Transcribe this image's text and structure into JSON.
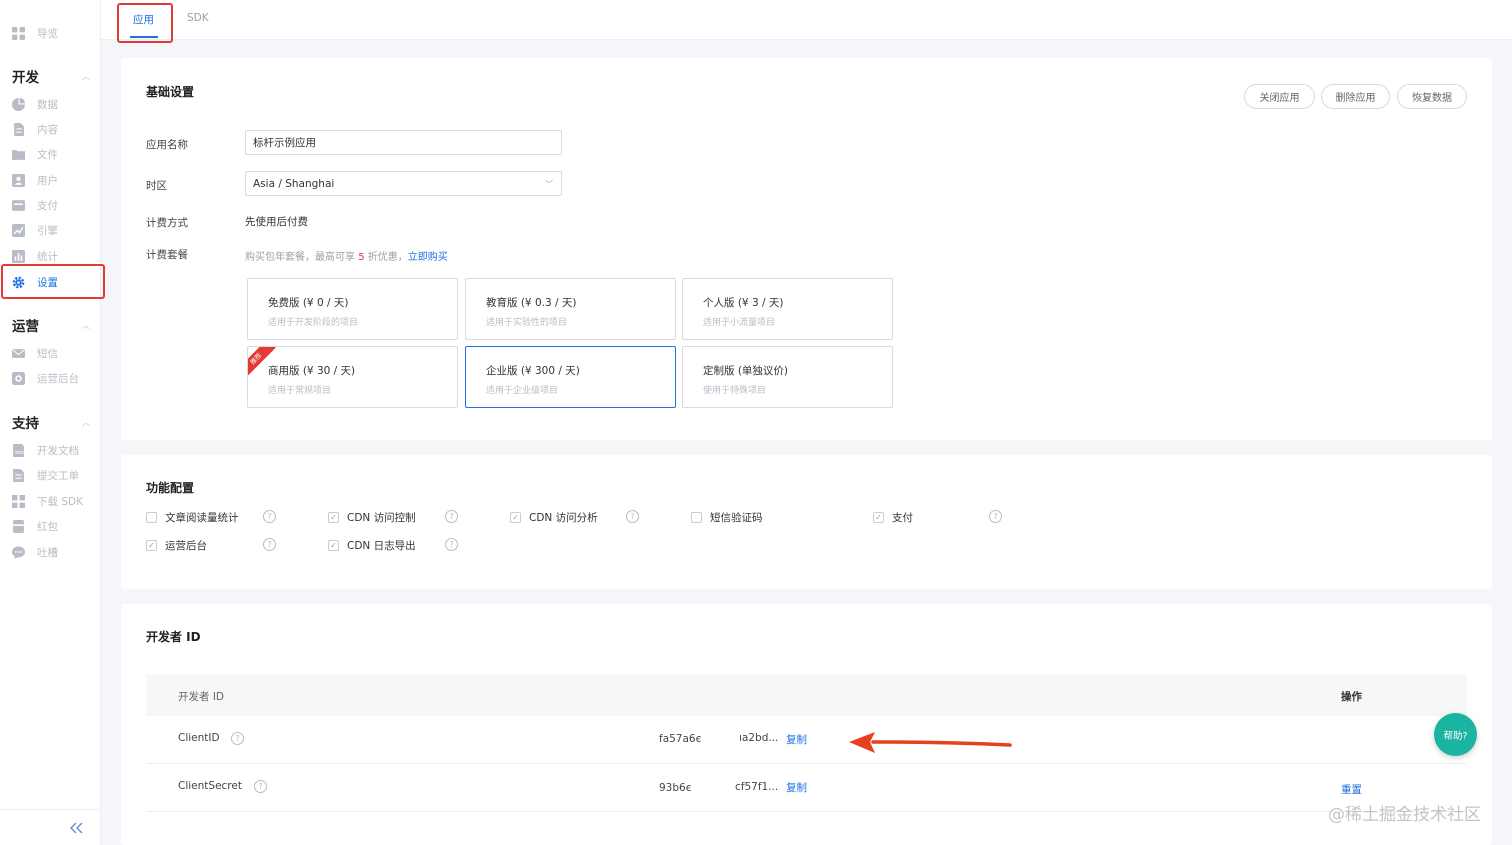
{
  "sidebar": {
    "top_item": {
      "label": "导览",
      "icon": "grid-icon"
    },
    "sections": [
      {
        "title": "开发",
        "items": [
          {
            "label": "数据",
            "icon": "pie-chart-icon"
          },
          {
            "label": "内容",
            "icon": "document-icon"
          },
          {
            "label": "文件",
            "icon": "folder-icon"
          },
          {
            "label": "用户",
            "icon": "user-icon"
          },
          {
            "label": "支付",
            "icon": "wallet-icon"
          },
          {
            "label": "引擎",
            "icon": "trend-icon"
          },
          {
            "label": "统计",
            "icon": "bar-chart-icon"
          },
          {
            "label": "设置",
            "icon": "gear-icon",
            "active": true
          }
        ]
      },
      {
        "title": "运营",
        "items": [
          {
            "label": "短信",
            "icon": "mail-icon"
          },
          {
            "label": "运营后台",
            "icon": "monitor-icon"
          }
        ]
      },
      {
        "title": "支持",
        "items": [
          {
            "label": "开发文档",
            "icon": "book-icon"
          },
          {
            "label": "提交工单",
            "icon": "ticket-icon"
          },
          {
            "label": "下载 SDK",
            "icon": "package-icon"
          },
          {
            "label": "红包",
            "icon": "gift-icon"
          },
          {
            "label": "吐槽",
            "icon": "chat-icon"
          }
        ]
      }
    ],
    "collapse_icon": "double-chevron-left-icon"
  },
  "tabs": [
    {
      "label": "应用",
      "active": true
    },
    {
      "label": "SDK",
      "active": false
    }
  ],
  "basic": {
    "title": "基础设置",
    "buttons": {
      "close": "关闭应用",
      "delete": "删除应用",
      "restore": "恢复数据"
    },
    "app_name_label": "应用名称",
    "app_name_value": "标杆示例应用",
    "timezone_label": "时区",
    "timezone_value": "Asia / Shanghai",
    "billing_label": "计费方式",
    "billing_value": "先使用后付费",
    "plan_label": "计费套餐",
    "plan_hint_pre": "购买包年套餐，最高可享 ",
    "plan_hint_num": "5",
    "plan_hint_post": " 折优惠，",
    "plan_hint_link": "立即购买",
    "plans": [
      {
        "name": "免费版 (¥ 0 / 天)",
        "desc": "适用于开发阶段的项目"
      },
      {
        "name": "教育版 (¥ 0.3 / 天)",
        "desc": "适用于实验性的项目"
      },
      {
        "name": "个人版 (¥ 3 / 天)",
        "desc": "适用于小流量项目"
      },
      {
        "name": "商用版 (¥ 30 / 天)",
        "desc": "适用于常规项目",
        "ribbon": "推荐"
      },
      {
        "name": "企业版 (¥ 300 / 天)",
        "desc": "适用于企业级项目",
        "selected": true
      },
      {
        "name": "定制版 (单独议价)",
        "desc": "使用于特殊项目"
      }
    ]
  },
  "features": {
    "title": "功能配置",
    "items": [
      {
        "label": "文章阅读量统计",
        "checked": false
      },
      {
        "label": "CDN 访问控制",
        "checked": true
      },
      {
        "label": "CDN 访问分析",
        "checked": true
      },
      {
        "label": "短信验证码",
        "checked": false
      },
      {
        "label": "支付",
        "checked": true
      },
      {
        "label": "运营后台",
        "checked": true
      },
      {
        "label": "CDN 日志导出",
        "checked": true
      }
    ]
  },
  "developer": {
    "title": "开发者 ID",
    "col_id": "开发者 ID",
    "col_action": "操作",
    "rows": [
      {
        "name": "ClientID",
        "value_a": "fa57a6є",
        "value_b": "ıa2bd...",
        "copy": "复制",
        "action": ""
      },
      {
        "name": "ClientSecret",
        "value_a": "93b6є",
        "value_b": "cf57f1...",
        "copy": "复制",
        "action": "重置"
      }
    ]
  },
  "help_button": "帮助?",
  "watermark": "@稀土掘金技术社区",
  "colors": {
    "accent": "#1f6fe5",
    "highlight": "#e53935",
    "help": "#1ab5a0"
  }
}
